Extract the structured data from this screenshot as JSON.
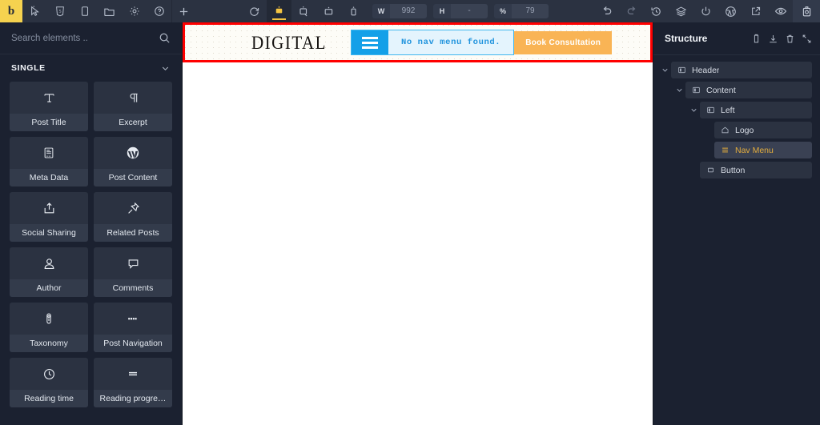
{
  "toolbar": {
    "logo_label": "b",
    "left_icons": [
      {
        "name": "cursor-icon",
        "title": "Select"
      },
      {
        "name": "html5-icon",
        "title": "HTML"
      },
      {
        "name": "page-icon",
        "title": "Pages"
      },
      {
        "name": "folder-icon",
        "title": "Folder"
      },
      {
        "name": "gear-icon",
        "title": "Settings"
      },
      {
        "name": "help-icon",
        "title": "Help"
      },
      {
        "name": "plus-icon",
        "title": "Add"
      }
    ],
    "center_icons": [
      {
        "name": "refresh-icon",
        "title": "Reload"
      },
      {
        "name": "desktop-icon",
        "title": "Desktop"
      },
      {
        "name": "laptop-icon",
        "title": "Laptop"
      },
      {
        "name": "tablet-icon",
        "title": "Tablet"
      },
      {
        "name": "mobile-icon",
        "title": "Mobile"
      }
    ],
    "fields": [
      {
        "label": "W",
        "value": "992"
      },
      {
        "label": "H",
        "value": "-"
      },
      {
        "label": "%",
        "value": "79"
      }
    ],
    "right_icons": [
      {
        "name": "undo-icon",
        "title": "Undo"
      },
      {
        "name": "redo-icon",
        "title": "Redo"
      },
      {
        "name": "history-icon",
        "title": "Revisions"
      },
      {
        "name": "layers-icon",
        "title": "Layers"
      },
      {
        "name": "power-icon",
        "title": "Toggle"
      },
      {
        "name": "wordpress-icon",
        "title": "WordPress"
      },
      {
        "name": "external-link-icon",
        "title": "Open"
      },
      {
        "name": "eye-icon",
        "title": "Preview"
      }
    ],
    "save_icon": "save-disk-icon"
  },
  "sidebar": {
    "search": {
      "placeholder": "Search elements ..",
      "value": ""
    },
    "category": {
      "label": "SINGLE",
      "expanded": true
    },
    "elements": [
      {
        "label": "Post Title",
        "icon": "text-t-icon"
      },
      {
        "label": "Excerpt",
        "icon": "pilcrow-icon"
      },
      {
        "label": "Meta Data",
        "icon": "meta-document-icon"
      },
      {
        "label": "Post Content",
        "icon": "wordpress-icon"
      },
      {
        "label": "Social Sharing",
        "icon": "share-icon"
      },
      {
        "label": "Related Posts",
        "icon": "pin-icon"
      },
      {
        "label": "Author",
        "icon": "user-icon"
      },
      {
        "label": "Comments",
        "icon": "comment-icon"
      },
      {
        "label": "Taxonomy",
        "icon": "tag-icon"
      },
      {
        "label": "Post Navigation",
        "icon": "post-nav-icon"
      },
      {
        "label": "Reading time",
        "icon": "clock-icon"
      },
      {
        "label": "Reading progre…",
        "icon": "progress-bar-icon"
      }
    ]
  },
  "canvas": {
    "selection_outline_color": "#ff0000",
    "header": {
      "logo_text": "DIGITAL",
      "nav_menu": {
        "burger_icon": "hamburger-icon",
        "notice": "No nav menu found.",
        "burger_color": "#14a0e8",
        "notice_bg": "#e4f4fd",
        "notice_color": "#1f93dd"
      },
      "cta": {
        "label": "Book Consultation",
        "color": "#f9b455"
      }
    }
  },
  "structure": {
    "title": "Structure",
    "actions": [
      {
        "name": "copy-icon",
        "title": "Copy"
      },
      {
        "name": "download-icon",
        "title": "Download"
      },
      {
        "name": "trash-icon",
        "title": "Delete"
      },
      {
        "name": "collapse-icon",
        "title": "Collapse"
      }
    ],
    "tree": [
      {
        "label": "Header",
        "icon": "container-icon",
        "depth": 0,
        "chevron": true,
        "selected": false
      },
      {
        "label": "Content",
        "icon": "container-icon",
        "depth": 1,
        "chevron": true,
        "selected": false
      },
      {
        "label": "Left",
        "icon": "container-icon",
        "depth": 2,
        "chevron": true,
        "selected": false
      },
      {
        "label": "Logo",
        "icon": "home-icon",
        "depth": 3,
        "chevron": false,
        "selected": false
      },
      {
        "label": "Nav Menu",
        "icon": "hamburger-icon",
        "depth": 3,
        "chevron": false,
        "selected": true
      },
      {
        "label": "Button",
        "icon": "square-icon",
        "depth": 2,
        "chevron": false,
        "selected": false
      }
    ]
  }
}
